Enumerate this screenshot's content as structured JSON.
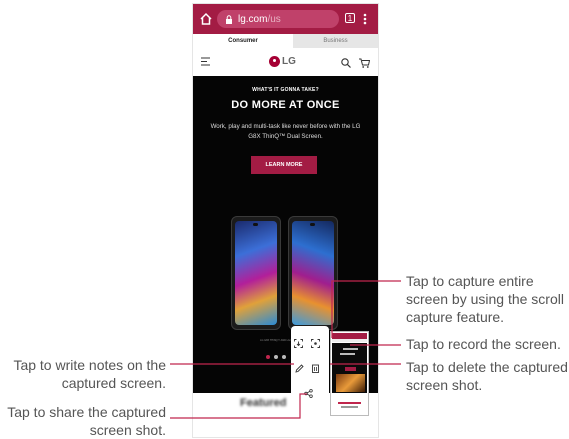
{
  "browser": {
    "url_domain": "lg.com",
    "url_path": "/us",
    "tab_count": "1"
  },
  "site": {
    "segment_consumer": "Consumer",
    "segment_business": "Business",
    "logo_text": "LG"
  },
  "hero": {
    "eyebrow": "WHAT'S IT GONNA TAKE?",
    "headline": "DO MORE AT ONCE",
    "subtext": "Work, play and multi-task like never before with the LG G8X ThinQ™ Dual Screen.",
    "cta": "LEARN MORE",
    "caption": "LG G8X THINQ™ AND LG DUAL SCREEN™"
  },
  "featured": {
    "label": "Featured"
  },
  "callouts": {
    "write_notes": [
      "Tap to write notes on the",
      "captured screen."
    ],
    "share": [
      "Tap to share the captured",
      "screen shot."
    ],
    "scroll_capture": [
      "Tap to capture entire",
      "screen by using the scroll",
      "capture feature."
    ],
    "record": [
      "Tap to record the screen."
    ],
    "delete": [
      "Tap to delete the captured",
      "screen shot."
    ]
  },
  "colors": {
    "brand": "#a31c44",
    "hero_bg": "#050505",
    "leader_line": "#c0264d"
  },
  "icons": {
    "home": "home-icon",
    "lock": "lock-icon",
    "tabs": "tabs-icon",
    "more": "more-vertical-icon",
    "menu": "hamburger-menu-icon",
    "search": "search-icon",
    "cart": "cart-icon",
    "scroll_capture": "scroll-capture-icon",
    "record": "screen-record-icon",
    "edit": "pen-edit-icon",
    "delete": "trash-icon",
    "share": "share-icon"
  }
}
